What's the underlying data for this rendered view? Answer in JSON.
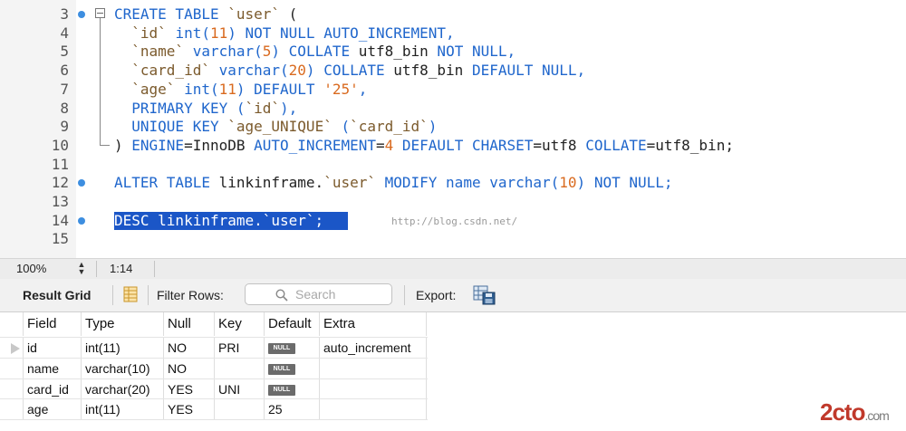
{
  "editor": {
    "lines": [
      {
        "n": "3",
        "bp": true,
        "fold": "start",
        "tokens": [
          {
            "t": "CREATE TABLE ",
            "c": "kw"
          },
          {
            "t": "`user`",
            "c": "id"
          },
          {
            "t": " (",
            "c": "plain"
          }
        ]
      },
      {
        "n": "4",
        "bp": false,
        "fold": "mid",
        "tokens": [
          {
            "t": "  `id` ",
            "c": "id"
          },
          {
            "t": "int(",
            "c": "kw"
          },
          {
            "t": "11",
            "c": "num"
          },
          {
            "t": ") NOT NULL AUTO_INCREMENT,",
            "c": "kw"
          }
        ]
      },
      {
        "n": "5",
        "bp": false,
        "fold": "mid",
        "tokens": [
          {
            "t": "  `name` ",
            "c": "id"
          },
          {
            "t": "varchar(",
            "c": "kw"
          },
          {
            "t": "5",
            "c": "num"
          },
          {
            "t": ") COLLATE ",
            "c": "kw"
          },
          {
            "t": "utf8_bin",
            "c": "plain"
          },
          {
            "t": " NOT NULL,",
            "c": "kw"
          }
        ]
      },
      {
        "n": "6",
        "bp": false,
        "fold": "mid",
        "tokens": [
          {
            "t": "  `card_id` ",
            "c": "id"
          },
          {
            "t": "varchar(",
            "c": "kw"
          },
          {
            "t": "20",
            "c": "num"
          },
          {
            "t": ") COLLATE ",
            "c": "kw"
          },
          {
            "t": "utf8_bin",
            "c": "plain"
          },
          {
            "t": " DEFAULT NULL,",
            "c": "kw"
          }
        ]
      },
      {
        "n": "7",
        "bp": false,
        "fold": "mid",
        "tokens": [
          {
            "t": "  `age` ",
            "c": "id"
          },
          {
            "t": "int(",
            "c": "kw"
          },
          {
            "t": "11",
            "c": "num"
          },
          {
            "t": ") DEFAULT ",
            "c": "kw"
          },
          {
            "t": "'25'",
            "c": "str"
          },
          {
            "t": ",",
            "c": "kw"
          }
        ]
      },
      {
        "n": "8",
        "bp": false,
        "fold": "mid",
        "tokens": [
          {
            "t": "  PRIMARY KEY (",
            "c": "kw"
          },
          {
            "t": "`id`",
            "c": "id"
          },
          {
            "t": "),",
            "c": "kw"
          }
        ]
      },
      {
        "n": "9",
        "bp": false,
        "fold": "mid",
        "tokens": [
          {
            "t": "  UNIQUE KEY ",
            "c": "kw"
          },
          {
            "t": "`age_UNIQUE`",
            "c": "id"
          },
          {
            "t": " (",
            "c": "kw"
          },
          {
            "t": "`card_id`",
            "c": "id"
          },
          {
            "t": ")",
            "c": "kw"
          }
        ]
      },
      {
        "n": "10",
        "bp": false,
        "fold": "end",
        "tokens": [
          {
            "t": ") ",
            "c": "plain"
          },
          {
            "t": "ENGINE",
            "c": "kw"
          },
          {
            "t": "=InnoDB ",
            "c": "plain"
          },
          {
            "t": "AUTO_INCREMENT",
            "c": "kw"
          },
          {
            "t": "=",
            "c": "plain"
          },
          {
            "t": "4",
            "c": "num"
          },
          {
            "t": " DEFAULT CHARSET",
            "c": "kw"
          },
          {
            "t": "=utf8 ",
            "c": "plain"
          },
          {
            "t": "COLLATE",
            "c": "kw"
          },
          {
            "t": "=utf8_bin;",
            "c": "plain"
          }
        ]
      },
      {
        "n": "11",
        "bp": false,
        "fold": "none",
        "tokens": []
      },
      {
        "n": "12",
        "bp": true,
        "fold": "none",
        "tokens": [
          {
            "t": "ALTER TABLE ",
            "c": "kw"
          },
          {
            "t": "linkinframe.",
            "c": "plain"
          },
          {
            "t": "`user`",
            "c": "id"
          },
          {
            "t": " MODIFY ",
            "c": "kw"
          },
          {
            "t": "name ",
            "c": "kw"
          },
          {
            "t": "varchar(",
            "c": "kw"
          },
          {
            "t": "10",
            "c": "num"
          },
          {
            "t": ") NOT NULL;",
            "c": "kw"
          }
        ]
      },
      {
        "n": "13",
        "bp": false,
        "fold": "none",
        "tokens": []
      },
      {
        "n": "14",
        "bp": true,
        "fold": "none",
        "selected": true,
        "tokens": [
          {
            "t": "DESC linkinframe.`user`;",
            "c": "sel-txt"
          }
        ]
      },
      {
        "n": "15",
        "bp": false,
        "fold": "none",
        "tokens": []
      }
    ],
    "watermark": "http://blog.csdn.net/"
  },
  "status": {
    "zoom": "100%",
    "position": "1:14"
  },
  "toolbar": {
    "result_grid_label": "Result Grid",
    "filter_label": "Filter Rows:",
    "search_placeholder": "Search",
    "export_label": "Export:"
  },
  "grid": {
    "columns": [
      "Field",
      "Type",
      "Null",
      "Key",
      "Default",
      "Extra"
    ],
    "rows": [
      {
        "field": "id",
        "type": "int(11)",
        "null": "NO",
        "key": "PRI",
        "default": "NULL",
        "default_is_null": true,
        "extra": "auto_increment",
        "current": true
      },
      {
        "field": "name",
        "type": "varchar(10)",
        "null": "NO",
        "key": "",
        "default": "NULL",
        "default_is_null": true,
        "extra": "",
        "current": false
      },
      {
        "field": "card_id",
        "type": "varchar(20)",
        "null": "YES",
        "key": "UNI",
        "default": "NULL",
        "default_is_null": true,
        "extra": "",
        "current": false
      },
      {
        "field": "age",
        "type": "int(11)",
        "null": "YES",
        "key": "",
        "default": "25",
        "default_is_null": false,
        "extra": "",
        "current": false
      }
    ]
  },
  "corner_logo": {
    "main": "2cto",
    "sub": ".com"
  },
  "colors": {
    "keyword": "#1f66cc",
    "identifier": "#7b5a2c",
    "number": "#d96a1f",
    "selection": "#1b56c7",
    "breakpoint": "#3d8ee0"
  }
}
